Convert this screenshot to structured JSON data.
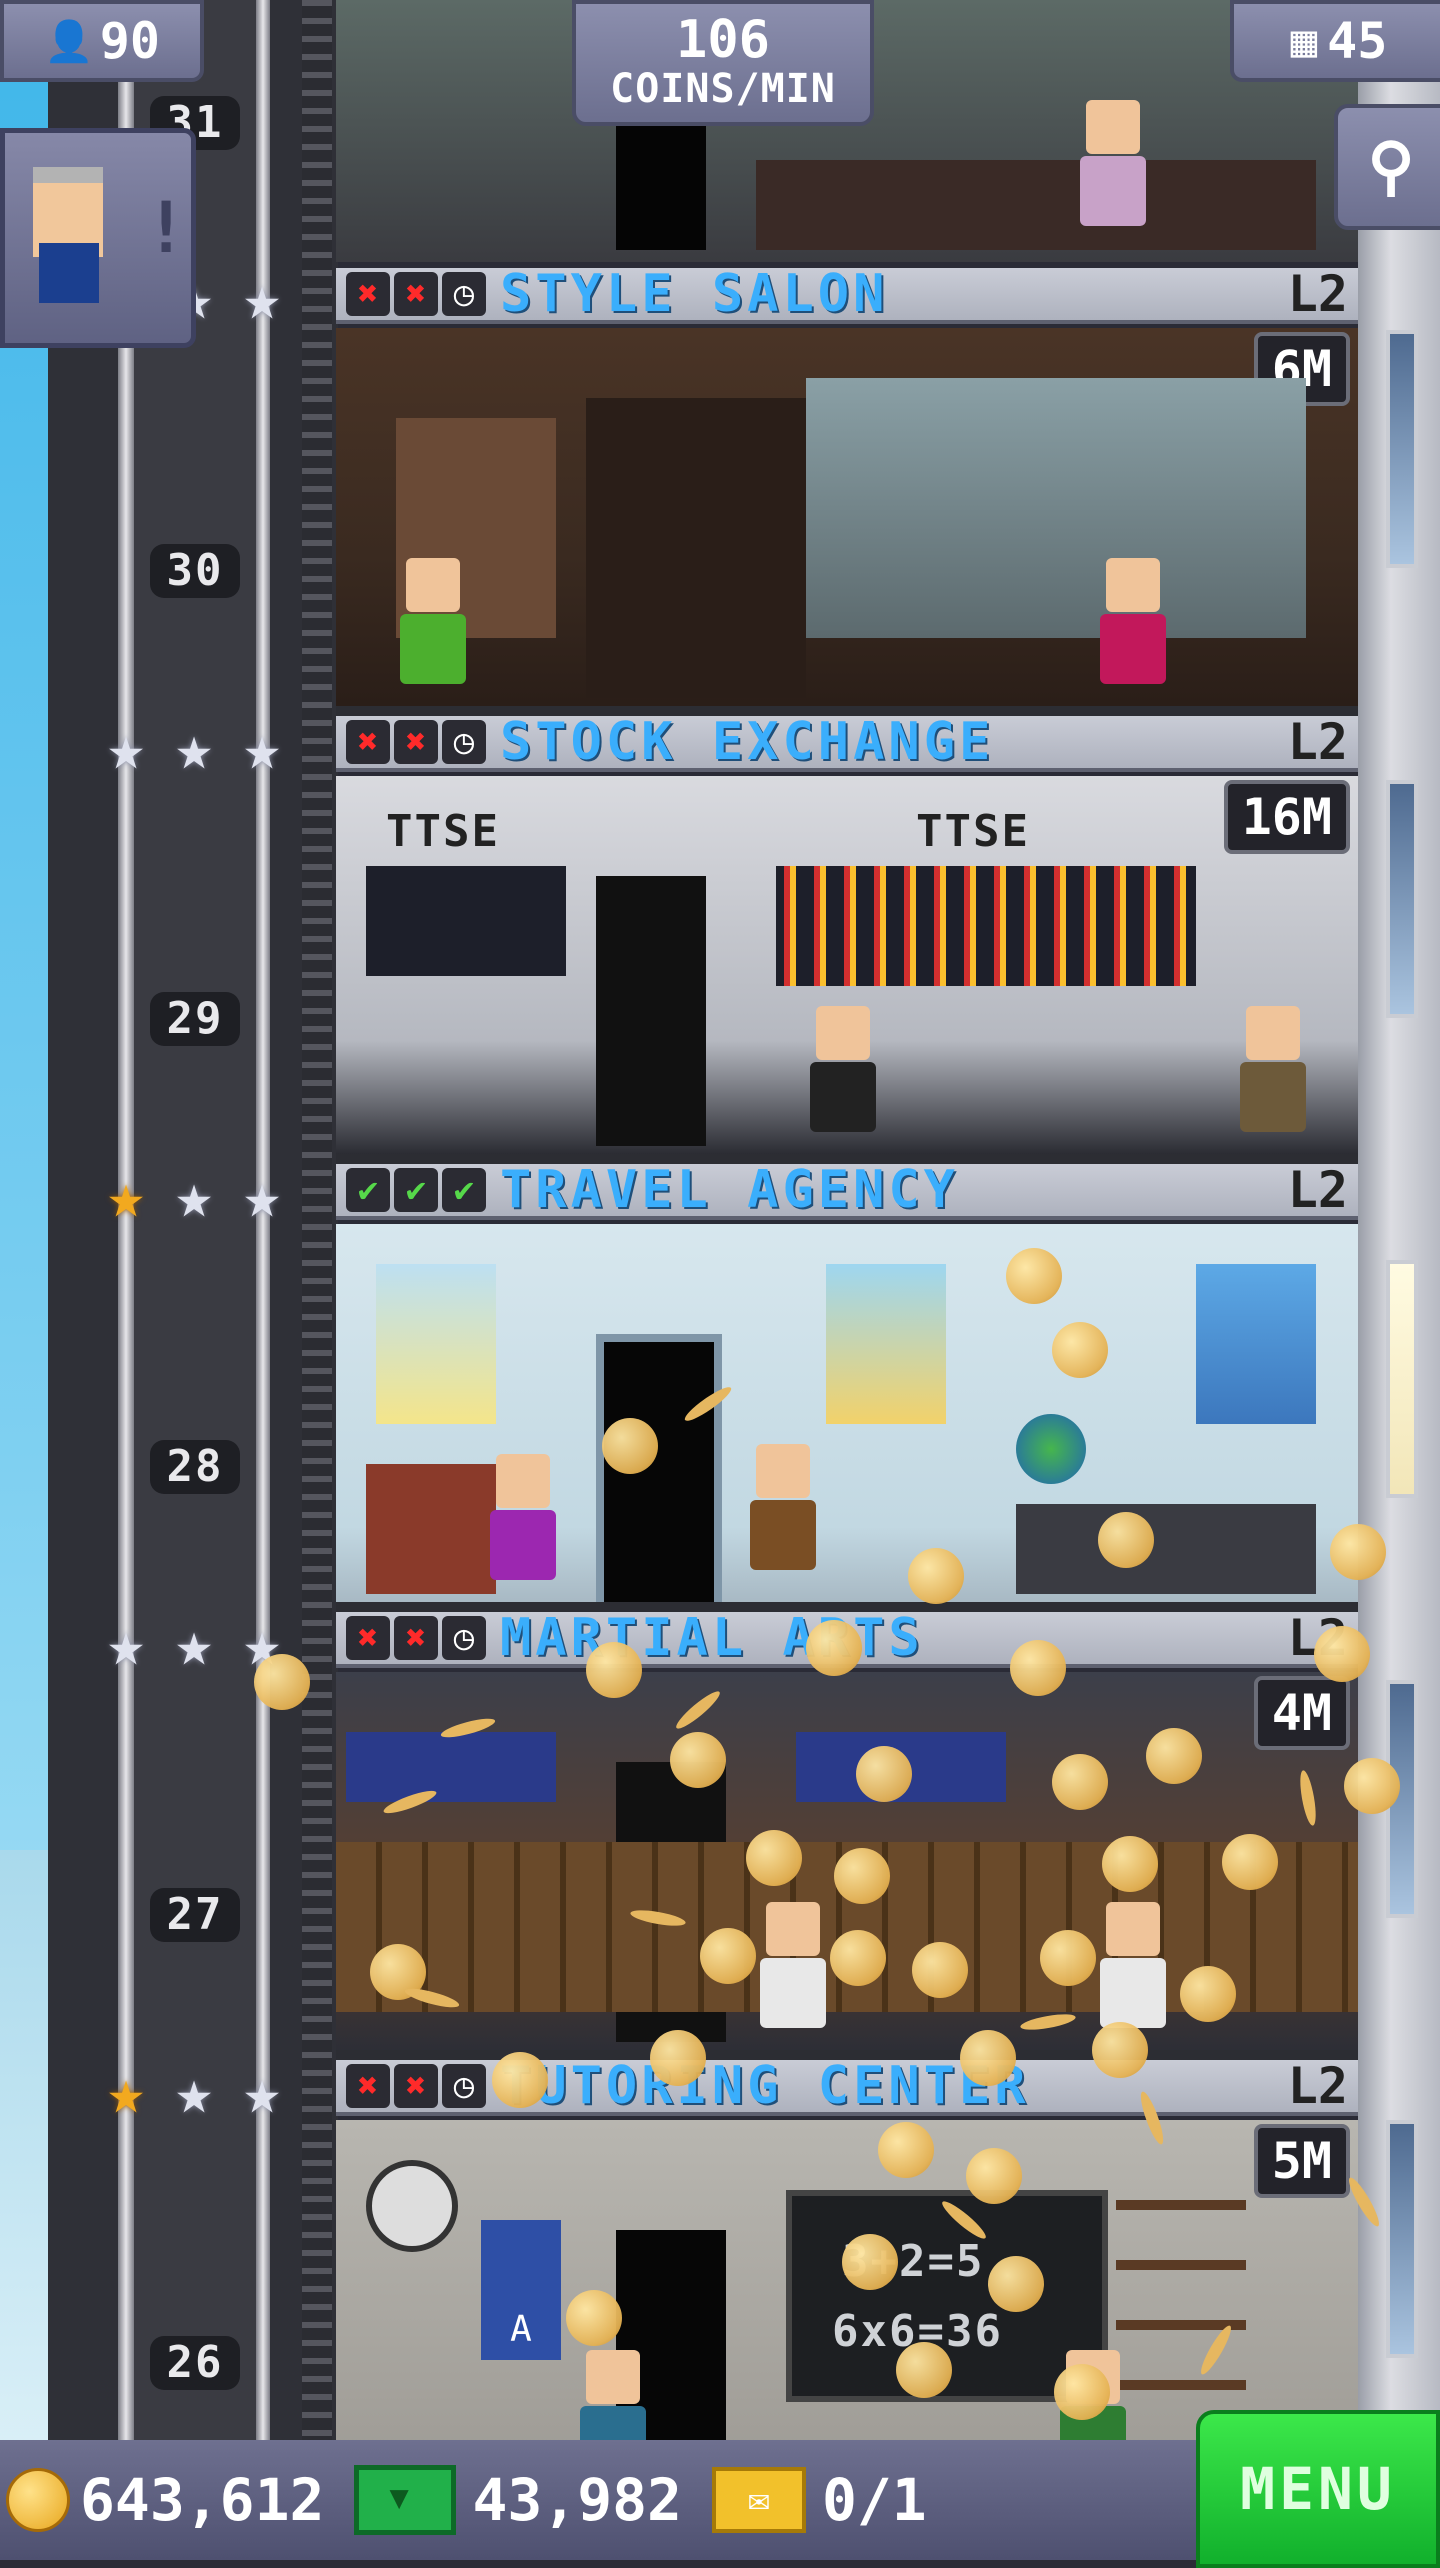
{
  "hud": {
    "population": "90",
    "coins_rate_value": "106",
    "coins_rate_unit": "COINS/MIN",
    "floors": "45"
  },
  "colors": {
    "banner_text": "#3aaefc",
    "x_mark": "#ff2a2a",
    "check_mark": "#56d84a",
    "menu_green": "#22c83a"
  },
  "floors": [
    {
      "number": "31",
      "name": "",
      "level": "",
      "timer": ""
    },
    {
      "number": "30",
      "name": "STYLE SALON",
      "level": "L2",
      "timer": "6M",
      "status": [
        "x",
        "x",
        "clock"
      ]
    },
    {
      "number": "29",
      "name": "STOCK EXCHANGE",
      "level": "L2",
      "timer": "16M",
      "status": [
        "x",
        "x",
        "clock"
      ]
    },
    {
      "number": "28",
      "name": "TRAVEL AGENCY",
      "level": "L2",
      "timer": "",
      "status": [
        "check",
        "check",
        "check"
      ]
    },
    {
      "number": "27",
      "name": "MARTIAL ARTS",
      "level": "L2",
      "timer": "4M",
      "status": [
        "x",
        "x",
        "clock"
      ]
    },
    {
      "number": "26",
      "name": "TUTORING CENTER",
      "level": "L2",
      "timer": "5M",
      "status": [
        "x",
        "x",
        "clock"
      ]
    }
  ],
  "signs": {
    "stock_left": "TTSE",
    "stock_right": "TTSE",
    "chalkboard_1": "3+2=5",
    "chalkboard_2": "6x6=36",
    "poster_letter": "A"
  },
  "bottom": {
    "coins": "643,612",
    "bux": "43,982",
    "tickets": "0/1",
    "menu_label": "MENU"
  },
  "icons": {
    "population": "person-icon",
    "floors": "building-icon",
    "zoom": "magnifier-icon",
    "coin": "coin-icon",
    "bux": "bux-icon",
    "ticket": "ticket-icon"
  }
}
